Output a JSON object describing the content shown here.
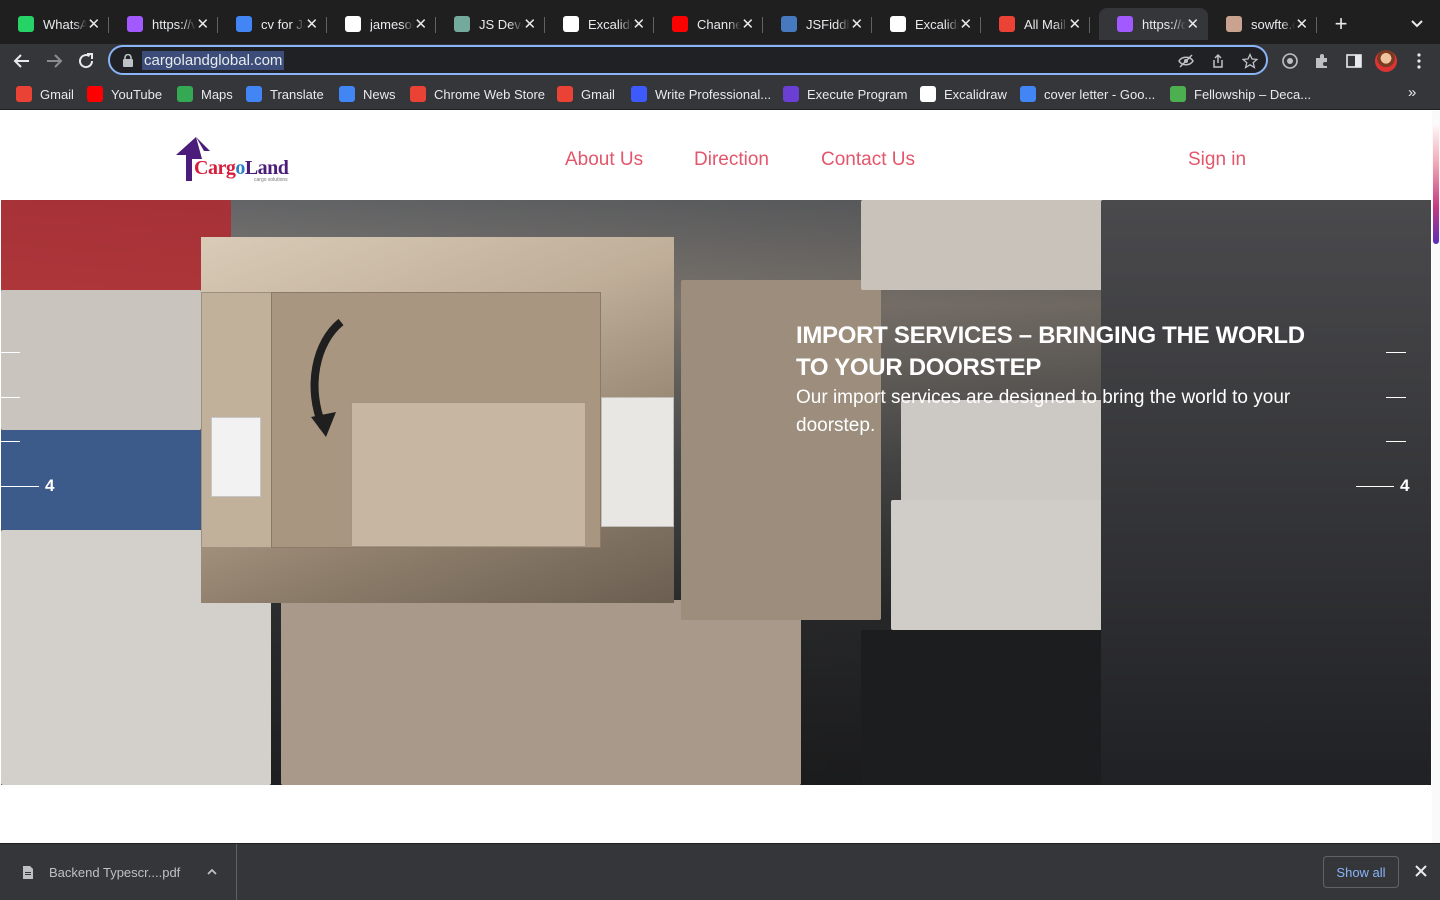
{
  "browser": {
    "tabs": [
      {
        "title": "WhatsApp",
        "icon": "whatsapp-icon",
        "color": "#25d366",
        "active": false
      },
      {
        "title": "https://vercel",
        "icon": "vercel-gradient-icon",
        "color": "#a259ff",
        "active": false
      },
      {
        "title": "cv for James",
        "icon": "google-docs-icon",
        "color": "#4285f4",
        "active": false
      },
      {
        "title": "jamesoh",
        "icon": "github-icon",
        "color": "#ffffff",
        "active": false
      },
      {
        "title": "JS Developer",
        "icon": "chatgpt-icon",
        "color": "#74aa9c",
        "active": false
      },
      {
        "title": "Excalidraw",
        "icon": "excalidraw-icon",
        "color": "#ffffff",
        "active": false
      },
      {
        "title": "Channel",
        "icon": "youtube-icon",
        "color": "#ff0000",
        "active": false
      },
      {
        "title": "JSFiddle",
        "icon": "jsfiddle-icon",
        "color": "#4679bd",
        "active": false
      },
      {
        "title": "Excalidraw",
        "icon": "excalidraw-icon",
        "color": "#ffffff",
        "active": false
      },
      {
        "title": "All Mail",
        "icon": "gmail-icon",
        "color": "#ea4335",
        "active": false
      },
      {
        "title": "https://cargo",
        "icon": "vercel-gradient-icon",
        "color": "#a259ff",
        "active": true
      },
      {
        "title": "sowfte.com",
        "icon": "sowfte-icon",
        "color": "#c9a38f",
        "active": false
      }
    ],
    "new_tab_label": "+",
    "url": "cargolandglobal.com",
    "bookmarks": [
      {
        "label": "Gmail",
        "icon": "gmail-icon",
        "color": "#ea4335"
      },
      {
        "label": "YouTube",
        "icon": "youtube-icon",
        "color": "#ff0000"
      },
      {
        "label": "Maps",
        "icon": "maps-icon",
        "color": "#34a853"
      },
      {
        "label": "Translate",
        "icon": "translate-icon",
        "color": "#4285f4"
      },
      {
        "label": "News",
        "icon": "news-icon",
        "color": "#4285f4"
      },
      {
        "label": "Chrome Web Store",
        "icon": "webstore-icon",
        "color": "#ea4335"
      },
      {
        "label": "Gmail",
        "icon": "gmail-icon",
        "color": "#ea4335"
      },
      {
        "label": "Write Professional...",
        "icon": "write-icon",
        "color": "#3d5afe"
      },
      {
        "label": "Execute Program",
        "icon": "execute-program-icon",
        "color": "#6b3fd4"
      },
      {
        "label": "Excalidraw",
        "icon": "excalidraw-icon",
        "color": "#ffffff"
      },
      {
        "label": "cover letter - Goo...",
        "icon": "google-docs-icon",
        "color": "#4285f4"
      },
      {
        "label": "Fellowship – Deca...",
        "icon": "fellowship-icon",
        "color": "#4caf50"
      }
    ],
    "bookmarks_more": "»"
  },
  "site": {
    "logo_text_cargo": "Carg",
    "logo_text_o": "o",
    "logo_text_land": "Land",
    "logo_tagline": "cargo solutions",
    "nav": [
      {
        "label": "About Us"
      },
      {
        "label": "Direction"
      },
      {
        "label": "Contact Us"
      }
    ],
    "signin_label": "Sign in",
    "accent_color": "#e3566b",
    "hero": {
      "title": "IMPORT SERVICES – BRINGING THE WORLD TO YOUR DOORSTEP",
      "subtitle": "Our import services are designed to bring the world to your doorstep.",
      "slide_number_left": "4",
      "slide_number_right": "4"
    }
  },
  "downloads": {
    "file_name": "Backend Typescr....pdf",
    "show_all_label": "Show all"
  }
}
